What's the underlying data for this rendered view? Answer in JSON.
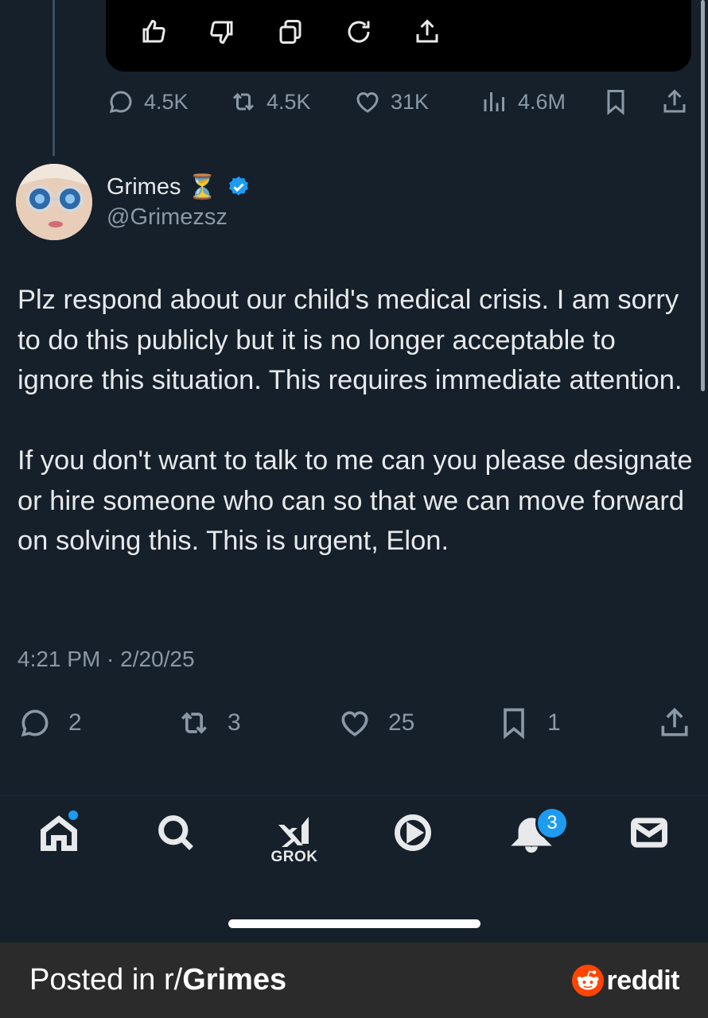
{
  "previous_tweet": {
    "card_icons": [
      "thumbs-up-icon",
      "thumbs-down-icon",
      "copy-icon",
      "regenerate-icon",
      "share-icon"
    ],
    "stats": {
      "replies": "4.5K",
      "reposts": "4.5K",
      "likes": "31K",
      "views": "4.6M"
    }
  },
  "tweet": {
    "author_name": "Grimes",
    "author_emoji": "⏳",
    "handle": "@Grimezsz",
    "paragraphs": [
      "Plz respond about our child's medical crisis.  I am sorry to do this publicly but it is no longer acceptable to ignore this situation.  This requires immediate attention.",
      "If you don't want to talk to me can you please designate or hire someone who can so that we can move forward on solving this.   This is urgent, Elon."
    ],
    "timestamp": "4:21 PM · 2/20/25",
    "actions": {
      "replies": "2",
      "reposts": "3",
      "likes": "25",
      "bookmarks": "1"
    }
  },
  "bottom_nav": {
    "grok_label": "GROK",
    "notifications_badge": "3"
  },
  "footer": {
    "posted_prefix": "Posted in r/",
    "subreddit": "Grimes",
    "brand": "reddit"
  },
  "colors": {
    "background": "#15202b",
    "accent": "#1d9bf0",
    "muted_text": "#8b98a5",
    "footer_bg": "#2b2b2b",
    "reddit_orange": "#ff4500"
  }
}
